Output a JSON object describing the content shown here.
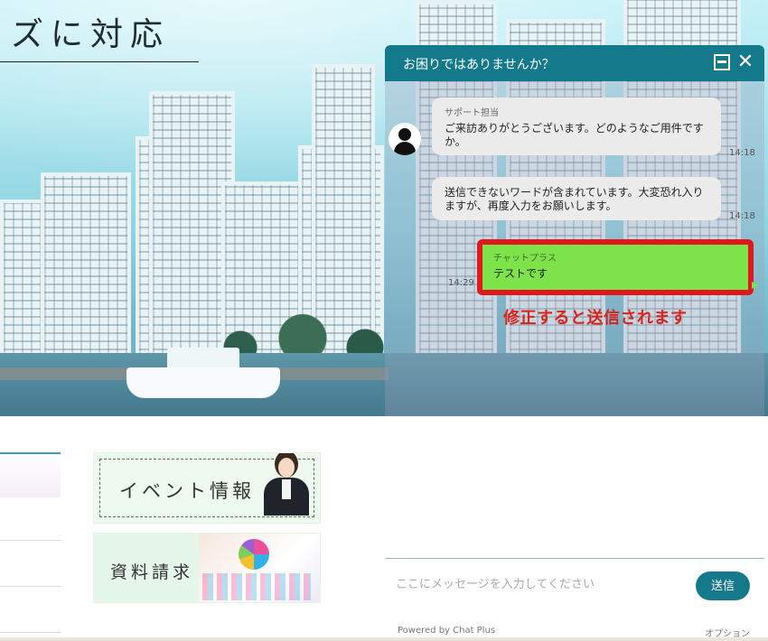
{
  "hero": {
    "title": "ズに対応"
  },
  "banners": {
    "event_label": "イベント情報",
    "document_label": "資料請求"
  },
  "chat": {
    "header_title": "お困りではありませんか？",
    "messages": [
      {
        "sender": "サポート担当",
        "text": "ご来訪ありがとうございます。どのようなご用件ですか。",
        "time": "14:18"
      },
      {
        "sender": "",
        "text": "送信できないワードが含まれています。大変恐れ入りますが、再度入力をお願いします。",
        "time": "14:18"
      },
      {
        "sender": "チャットプラス",
        "text": "テストです",
        "time": "14:29"
      }
    ],
    "annotation": "修正すると送信されます",
    "input_placeholder": "ここにメッセージを入力してください",
    "send_label": "送信",
    "powered_by": "Powered by Chat Plus",
    "option_label": "オプション",
    "accent_color": "#14798a",
    "own_bubble_color": "#7ee24a",
    "highlight_color": "#e0181b"
  }
}
